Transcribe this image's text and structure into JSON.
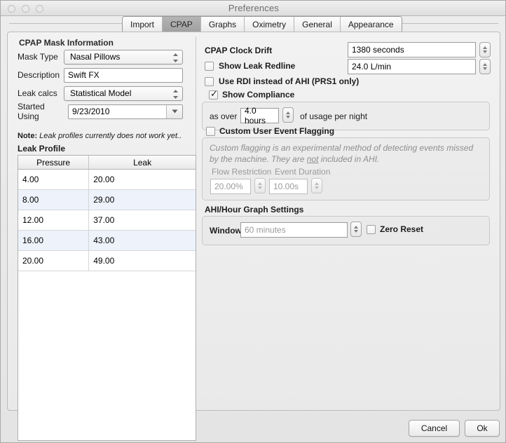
{
  "window": {
    "title": "Preferences",
    "traffic_lights": [
      "close-button",
      "minimize-button",
      "zoom-button"
    ]
  },
  "tabs": [
    {
      "label": "Import",
      "selected": false
    },
    {
      "label": "CPAP",
      "selected": true
    },
    {
      "label": "Graphs",
      "selected": false
    },
    {
      "label": "Oximetry",
      "selected": false
    },
    {
      "label": "General",
      "selected": false
    },
    {
      "label": "Appearance",
      "selected": false
    }
  ],
  "left": {
    "group_title": "CPAP Mask Information",
    "mask_type": {
      "label": "Mask Type",
      "value": "Nasal Pillows"
    },
    "description": {
      "label": "Description",
      "value": "Swift FX"
    },
    "leak_calcs": {
      "label": "Leak calcs",
      "value": "Statistical Model"
    },
    "started_using": {
      "label": "Started Using",
      "value": "9/23/2010"
    },
    "note_prefix": "Note:",
    "note_text": "Leak profiles currently does not work yet..",
    "leak_profile_label": "Leak Profile",
    "table": {
      "columns": [
        "Pressure",
        "Leak"
      ],
      "rows": [
        [
          "4.00",
          "20.00"
        ],
        [
          "8.00",
          "29.00"
        ],
        [
          "12.00",
          "37.00"
        ],
        [
          "16.00",
          "43.00"
        ],
        [
          "20.00",
          "49.00"
        ]
      ]
    }
  },
  "right": {
    "clock_drift": {
      "label": "CPAP Clock Drift",
      "value": "1380 seconds"
    },
    "show_leak_redline": {
      "label": "Show Leak Redline",
      "checked": false,
      "value": "24.0 L/min"
    },
    "use_rdi": {
      "label": "Use RDI instead of AHI (PRS1 only)",
      "checked": false
    },
    "show_compliance": {
      "label": "Show Compliance",
      "checked": true
    },
    "compliance": {
      "prefix": "as over",
      "value": "4.0 hours",
      "suffix": "of usage per night"
    },
    "custom_flagging": {
      "label": "Custom User Event Flagging",
      "checked": false,
      "description_part1": "Custom flagging is an experimental method of detecting events missed by the machine. They are ",
      "description_underlined": "not",
      "description_part2": " included in AHI.",
      "flow_restriction": {
        "label": "Flow Restriction",
        "value": "20.00%"
      },
      "event_duration": {
        "label": "Event Duration",
        "value": "10.00s"
      }
    },
    "ahi_graph": {
      "title": "AHI/Hour Graph Settings",
      "window_label": "Window",
      "window_value": "60 minutes",
      "zero_reset": {
        "label": "Zero Reset",
        "checked": false
      }
    }
  },
  "footer": {
    "cancel": "Cancel",
    "ok": "Ok"
  },
  "colors": {
    "window_bg": "#ececec",
    "selected_tab": "#a8a8a8",
    "alt_row": "#edf2fb",
    "disabled_text": "#9a9a9a"
  }
}
